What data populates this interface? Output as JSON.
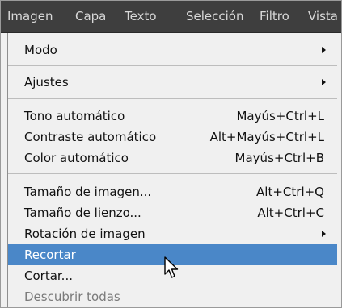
{
  "menubar": {
    "items": [
      {
        "label": "Imagen",
        "active": true
      },
      {
        "label": "Capa",
        "active": false
      },
      {
        "label": "Texto",
        "active": false
      },
      {
        "label": "Selección",
        "active": false
      },
      {
        "label": "Filtro",
        "active": false
      },
      {
        "label": "Vista",
        "active": false
      }
    ]
  },
  "menu": {
    "items": [
      {
        "label": "Modo",
        "shortcut": "",
        "submenu": true,
        "state": "normal"
      },
      {
        "label": "Ajustes",
        "shortcut": "",
        "submenu": true,
        "state": "normal"
      },
      {
        "label": "Tono automático",
        "shortcut": "Mayús+Ctrl+L",
        "submenu": false,
        "state": "normal"
      },
      {
        "label": "Contraste automático",
        "shortcut": "Alt+Mayús+Ctrl+L",
        "submenu": false,
        "state": "normal"
      },
      {
        "label": "Color automático",
        "shortcut": "Mayús+Ctrl+B",
        "submenu": false,
        "state": "normal"
      },
      {
        "label": "Tamaño de imagen...",
        "shortcut": "Alt+Ctrl+Q",
        "submenu": false,
        "state": "normal"
      },
      {
        "label": "Tamaño de lienzo...",
        "shortcut": "Alt+Ctrl+C",
        "submenu": false,
        "state": "normal"
      },
      {
        "label": "Rotación de imagen",
        "shortcut": "",
        "submenu": true,
        "state": "normal"
      },
      {
        "label": "Recortar",
        "shortcut": "",
        "submenu": false,
        "state": "highlighted"
      },
      {
        "label": "Cortar...",
        "shortcut": "",
        "submenu": false,
        "state": "normal"
      },
      {
        "label": "Descubrir todas",
        "shortcut": "",
        "submenu": false,
        "state": "disabled"
      }
    ]
  },
  "colors": {
    "menubar_bg": "#3e3e3e",
    "active_menu_bg": "#1e1e1e",
    "highlight_bg": "#4a87c8",
    "dropdown_bg": "#f0f0f0",
    "disabled_text": "#7a7a7a"
  },
  "icons": {
    "submenu": "submenu-arrow-icon",
    "cursor": "mouse-pointer-icon"
  }
}
